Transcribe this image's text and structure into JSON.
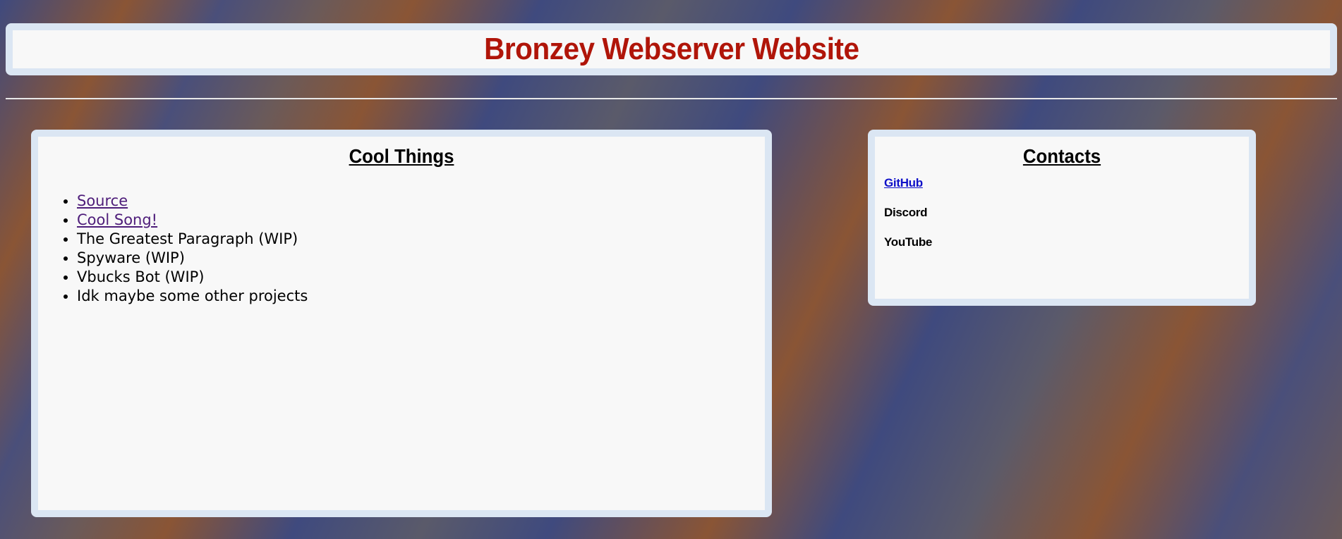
{
  "header": {
    "title": "Bronzey Webserver Website"
  },
  "cool_things": {
    "heading": "Cool Things",
    "items": [
      {
        "label": "Source",
        "link": true
      },
      {
        "label": "Cool Song!",
        "link": true
      },
      {
        "label": "The Greatest Paragraph (WIP)",
        "link": false
      },
      {
        "label": "Spyware (WIP)",
        "link": false
      },
      {
        "label": "Vbucks Bot (WIP)",
        "link": false
      },
      {
        "label": "Idk maybe some other projects",
        "link": false
      }
    ]
  },
  "contacts": {
    "heading": "Contacts",
    "items": [
      {
        "label": "GitHub",
        "link": true
      },
      {
        "label": "Discord",
        "link": false
      },
      {
        "label": "YouTube",
        "link": false
      }
    ]
  },
  "colors": {
    "title": "#b01509",
    "visited_link": "#4e1d7a",
    "link": "#0f10c8",
    "panel_border": "#dbe6f3",
    "panel_bg": "#f8f8f8"
  }
}
